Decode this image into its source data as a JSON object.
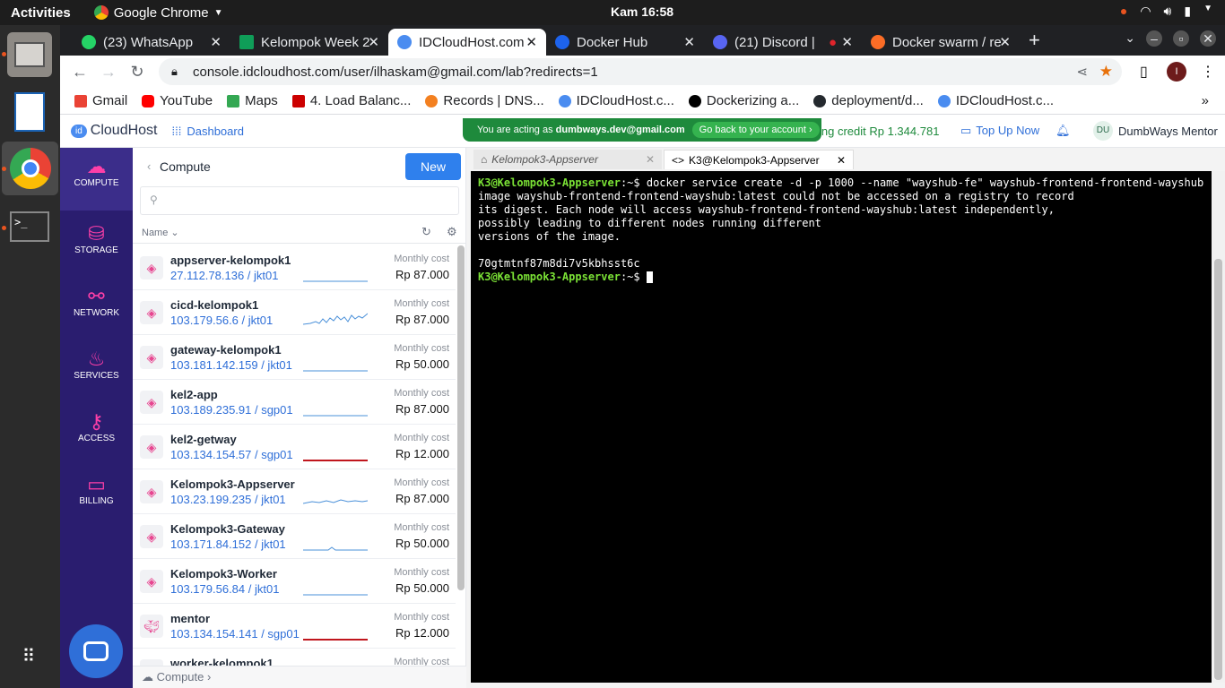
{
  "system": {
    "activities": "Activities",
    "app_name": "Google Chrome",
    "clock": "Kam 16:58"
  },
  "tabs": [
    {
      "label": "(23) WhatsApp",
      "color": "#25d366"
    },
    {
      "label": "Kelompok Week 2",
      "color": "#0f9d58"
    },
    {
      "label": "IDCloudHost.com",
      "color": "#4a8cf0",
      "active": true
    },
    {
      "label": "Docker Hub",
      "color": "#1d63ed"
    },
    {
      "label": "(21) Discord |",
      "color": "#5865f2"
    },
    {
      "label": "Docker swarm / re",
      "color": "#fc6d26"
    }
  ],
  "url": "console.idcloudhost.com/user/ilhaskam@gmail.com/lab?redirects=1",
  "bookmarks": [
    {
      "label": "Gmail",
      "color": "#ea4335"
    },
    {
      "label": "YouTube",
      "color": "#ff0000"
    },
    {
      "label": "Maps",
      "color": "#34a853"
    },
    {
      "label": "4. Load Balanc...",
      "color": "#cc0000"
    },
    {
      "label": "Records | DNS...",
      "color": "#f38020"
    },
    {
      "label": "IDCloudHost.c...",
      "color": "#4a8cf0"
    },
    {
      "label": "Dockerizing a...",
      "color": "#000000"
    },
    {
      "label": "deployment/d...",
      "color": "#24292e"
    },
    {
      "label": "IDCloudHost.c...",
      "color": "#4a8cf0"
    }
  ],
  "header": {
    "logo": "CloudHost",
    "dashboard": "Dashboard",
    "acting_prefix": "You are acting as",
    "acting_user": "dumbways.dev@gmail.com",
    "go_back": "Go back to your account",
    "credit": "ing credit Rp 1.344.781",
    "topup": "Top Up Now",
    "user_initials": "DU",
    "user_name": "DumbWays Mentor"
  },
  "sidenav": [
    {
      "label": "COMPUTE",
      "active": true
    },
    {
      "label": "STORAGE"
    },
    {
      "label": "NETWORK"
    },
    {
      "label": "SERVICES"
    },
    {
      "label": "ACCESS"
    },
    {
      "label": "BILLING"
    }
  ],
  "list": {
    "title": "Compute",
    "new_button": "New",
    "sort_label": "Name",
    "footer": "Compute",
    "cost_label": "Monthly cost",
    "servers": [
      {
        "name": "appserver-kelompok1",
        "ip": "27.112.78.136 / jkt01",
        "price": "Rp 87.000",
        "spark": "flat"
      },
      {
        "name": "cicd-kelompok1",
        "ip": "103.179.56.6 / jkt01",
        "price": "Rp 87.000",
        "spark": "busy"
      },
      {
        "name": "gateway-kelompok1",
        "ip": "103.181.142.159 / jkt01",
        "price": "Rp 50.000",
        "spark": "flat"
      },
      {
        "name": "kel2-app",
        "ip": "103.189.235.91 / sgp01",
        "price": "Rp 87.000",
        "spark": "flat"
      },
      {
        "name": "kel2-getway",
        "ip": "103.134.154.57 / sgp01",
        "price": "Rp 12.000",
        "spark": "red"
      },
      {
        "name": "Kelompok3-Appserver",
        "ip": "103.23.199.235 / jkt01",
        "price": "Rp 87.000",
        "spark": "low"
      },
      {
        "name": "Kelompok3-Gateway",
        "ip": "103.171.84.152 / jkt01",
        "price": "Rp 50.000",
        "spark": "tiny"
      },
      {
        "name": "Kelompok3-Worker",
        "ip": "103.179.56.84 / jkt01",
        "price": "Rp 50.000",
        "spark": "flat"
      },
      {
        "name": "mentor",
        "ip": "103.134.154.141 / sgp01",
        "price": "Rp 12.000",
        "spark": "red"
      },
      {
        "name": "worker-kelompok1",
        "ip": "",
        "price": "",
        "spark": "none"
      }
    ]
  },
  "terminal": {
    "tab1": "Kelompok3-Appserver",
    "tab2": "K3@Kelompok3-Appserver",
    "prompt_user": "K3@Kelompok3-Appserver",
    "prompt_suffix": ":~$ ",
    "command": "docker service create -d -p 1000 --name \"wayshub-fe\" wayshub-frontend-frontend-wayshub",
    "output": [
      "image wayshub-frontend-frontend-wayshub:latest could not be accessed on a registry to record",
      "its digest. Each node will access wayshub-frontend-frontend-wayshub:latest independently,",
      "possibly leading to different nodes running different",
      "versions of the image.",
      "",
      "70gtmtnf87m8di7v5kbhsst6c"
    ]
  }
}
